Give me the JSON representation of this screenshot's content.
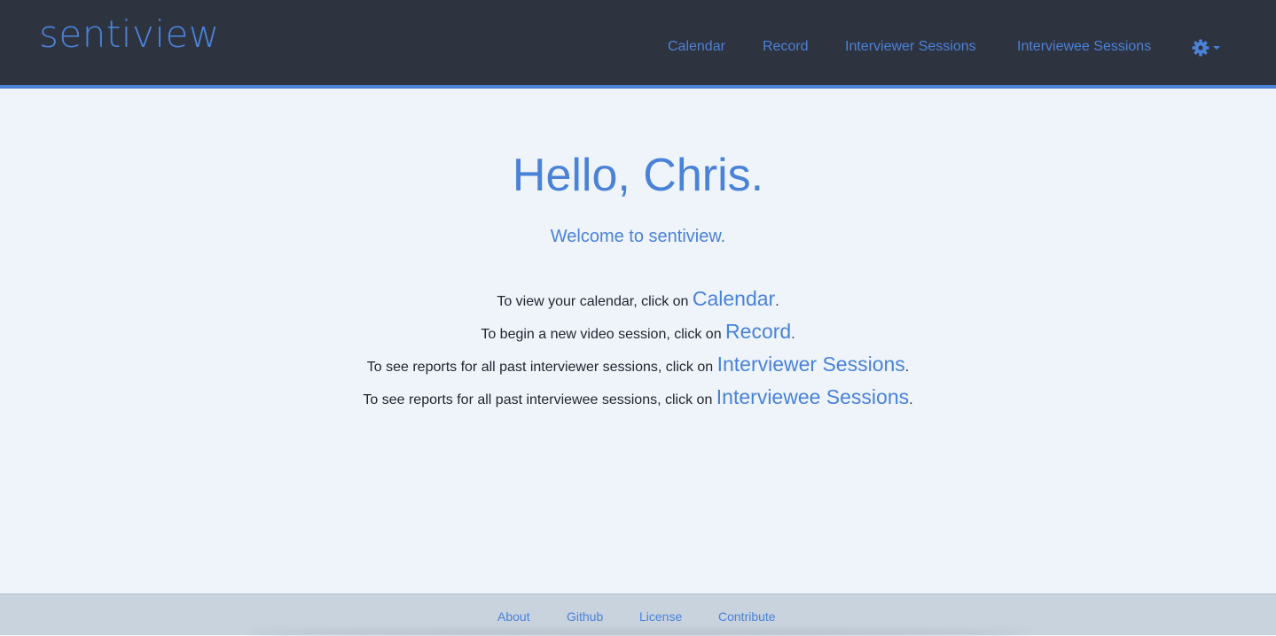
{
  "header": {
    "brand": "sentiview",
    "nav": {
      "calendar": "Calendar",
      "record": "Record",
      "interviewer_sessions": "Interviewer Sessions",
      "interviewee_sessions": "Interviewee Sessions"
    },
    "settings_icon": "gear-icon"
  },
  "main": {
    "greeting": "Hello, Chris.",
    "welcome": "Welcome to sentiview.",
    "instructions": [
      {
        "prefix": "To view your calendar, click on ",
        "link": "Calendar",
        "suffix": "."
      },
      {
        "prefix": "To begin a new video session, click on ",
        "link": "Record",
        "suffix": "."
      },
      {
        "prefix": "To see reports for all past interviewer sessions, click on ",
        "link": "Interviewer Sessions",
        "suffix": "."
      },
      {
        "prefix": "To see reports for all past interviewee sessions, click on ",
        "link": "Interviewee Sessions",
        "suffix": "."
      }
    ]
  },
  "footer": {
    "about": "About",
    "github": "Github",
    "license": "License",
    "contribute": "Contribute"
  },
  "colors": {
    "navbar_bg": "#2e3340",
    "accent": "#4a82d8",
    "page_bg": "#eef4f9",
    "footer_bg": "#c9d3de",
    "body_text": "#1f2430"
  }
}
